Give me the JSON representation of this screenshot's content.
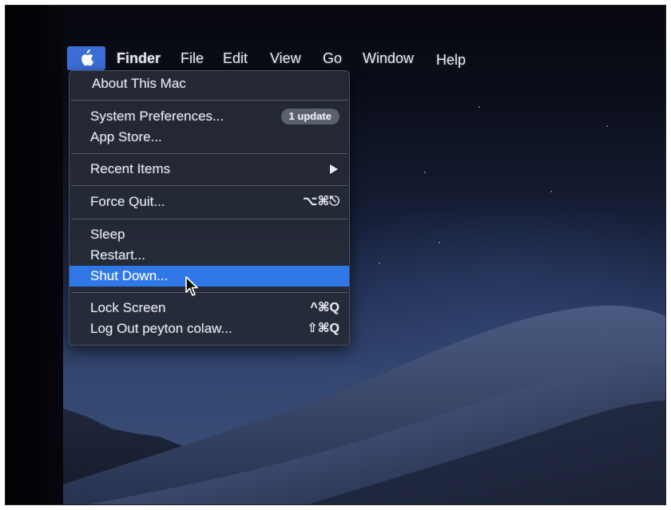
{
  "menubar": {
    "apple_icon": "apple-logo-icon",
    "items": [
      {
        "label": "Finder",
        "bold": true
      },
      {
        "label": "File"
      },
      {
        "label": "Edit"
      },
      {
        "label": "View"
      },
      {
        "label": "Go"
      },
      {
        "label": "Window"
      },
      {
        "label": "Help"
      }
    ]
  },
  "apple_menu": {
    "about": "About This Mac",
    "system_preferences": "System Preferences...",
    "update_badge": "1 update",
    "app_store": "App Store...",
    "recent_items": "Recent Items",
    "force_quit": "Force Quit...",
    "force_quit_shortcut": "⌥⌘⎋",
    "sleep": "Sleep",
    "restart": "Restart...",
    "shut_down": "Shut Down...",
    "lock_screen": "Lock Screen",
    "lock_screen_shortcut": "^⌘Q",
    "log_out": "Log Out peyton colaw...",
    "log_out_shortcut": "⇧⌘Q",
    "highlighted_item": "Shut Down..."
  },
  "colors": {
    "highlight": "#2f78e6",
    "apple_menu_active": "#3b6fd6",
    "menu_background": "#262a36"
  }
}
